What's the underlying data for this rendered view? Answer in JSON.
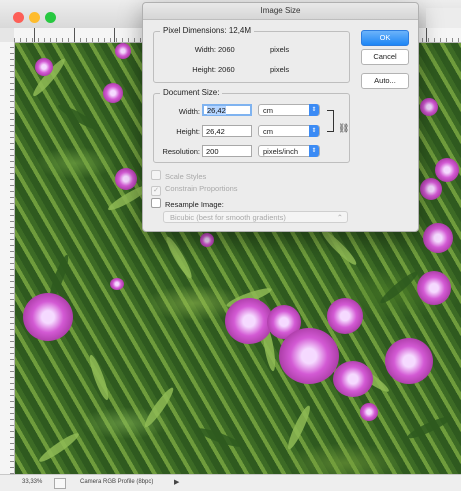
{
  "dialog": {
    "title": "Image Size",
    "pixel_dimensions": {
      "legend": "Pixel Dimensions:",
      "size": "12,4M",
      "width_label": "Width:",
      "width_value": "2060",
      "width_unit": "pixels",
      "height_label": "Height:",
      "height_value": "2060",
      "height_unit": "pixels"
    },
    "document_size": {
      "legend": "Document Size:",
      "width_label": "Width:",
      "width_value": "26,42",
      "width_unit": "cm",
      "height_label": "Height:",
      "height_value": "26,42",
      "height_unit": "cm",
      "resolution_label": "Resolution:",
      "resolution_value": "200",
      "resolution_unit": "pixels/inch"
    },
    "buttons": {
      "ok": "OK",
      "cancel": "Cancel",
      "auto": "Auto..."
    },
    "options": {
      "scale_styles": "Scale Styles",
      "constrain_proportions": "Constrain Proportions",
      "resample_image": "Resample Image:",
      "resample_method": "Bicubic (best for smooth gradients)"
    },
    "accent_color": "#1e86f5"
  },
  "status_bar": {
    "zoom": "33,33%",
    "profile": "Camera RGB Profile (8bpc)"
  },
  "icons": {
    "stepper": "up-down-chevron-icon",
    "link": "chain-link-icon",
    "constrain_check": "checkmark-icon",
    "status_arrow": "play-triangle-icon"
  }
}
